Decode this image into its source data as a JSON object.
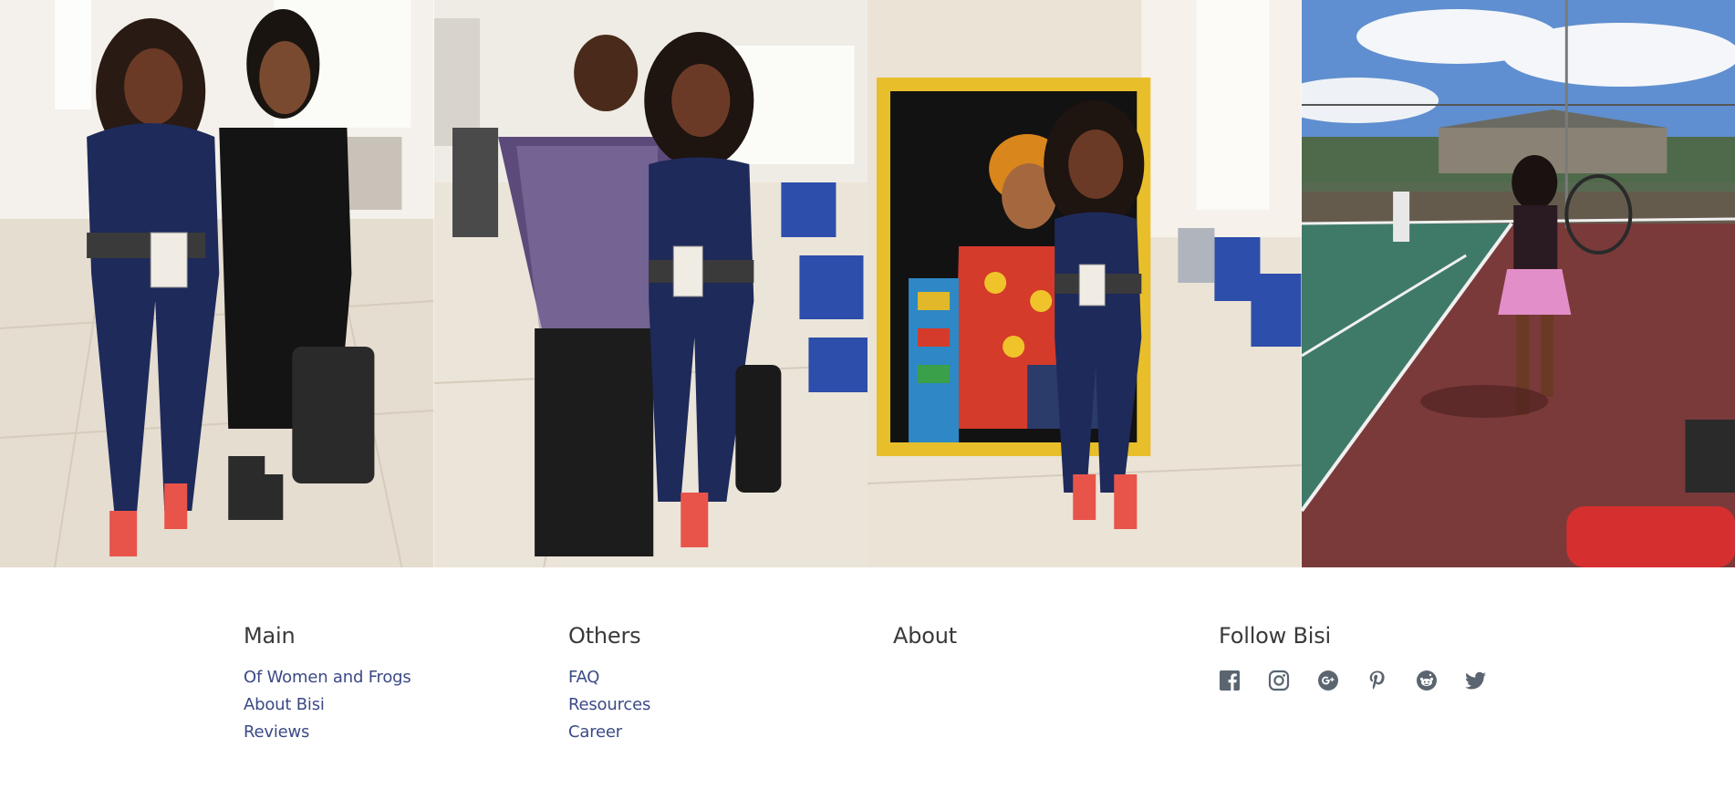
{
  "gallery": {
    "photos": [
      {
        "name": "photo-two-women-classroom"
      },
      {
        "name": "photo-man-and-woman-classroom"
      },
      {
        "name": "photo-woman-with-painting"
      },
      {
        "name": "photo-woman-tennis-court"
      }
    ]
  },
  "footer": {
    "main": {
      "heading": "Main",
      "links": [
        "Of Women and Frogs",
        "About Bisi",
        "Reviews"
      ]
    },
    "others": {
      "heading": "Others",
      "links": [
        "FAQ",
        "Resources",
        "Career"
      ]
    },
    "about": {
      "heading": "About"
    },
    "follow": {
      "heading": "Follow Bisi",
      "icons": [
        "facebook-icon",
        "instagram-icon",
        "google-plus-icon",
        "pinterest-icon",
        "reddit-icon",
        "twitter-icon"
      ]
    },
    "colors": {
      "heading": "#3a3a3a",
      "link": "#3b4a86",
      "icon": "#5a6570"
    }
  }
}
